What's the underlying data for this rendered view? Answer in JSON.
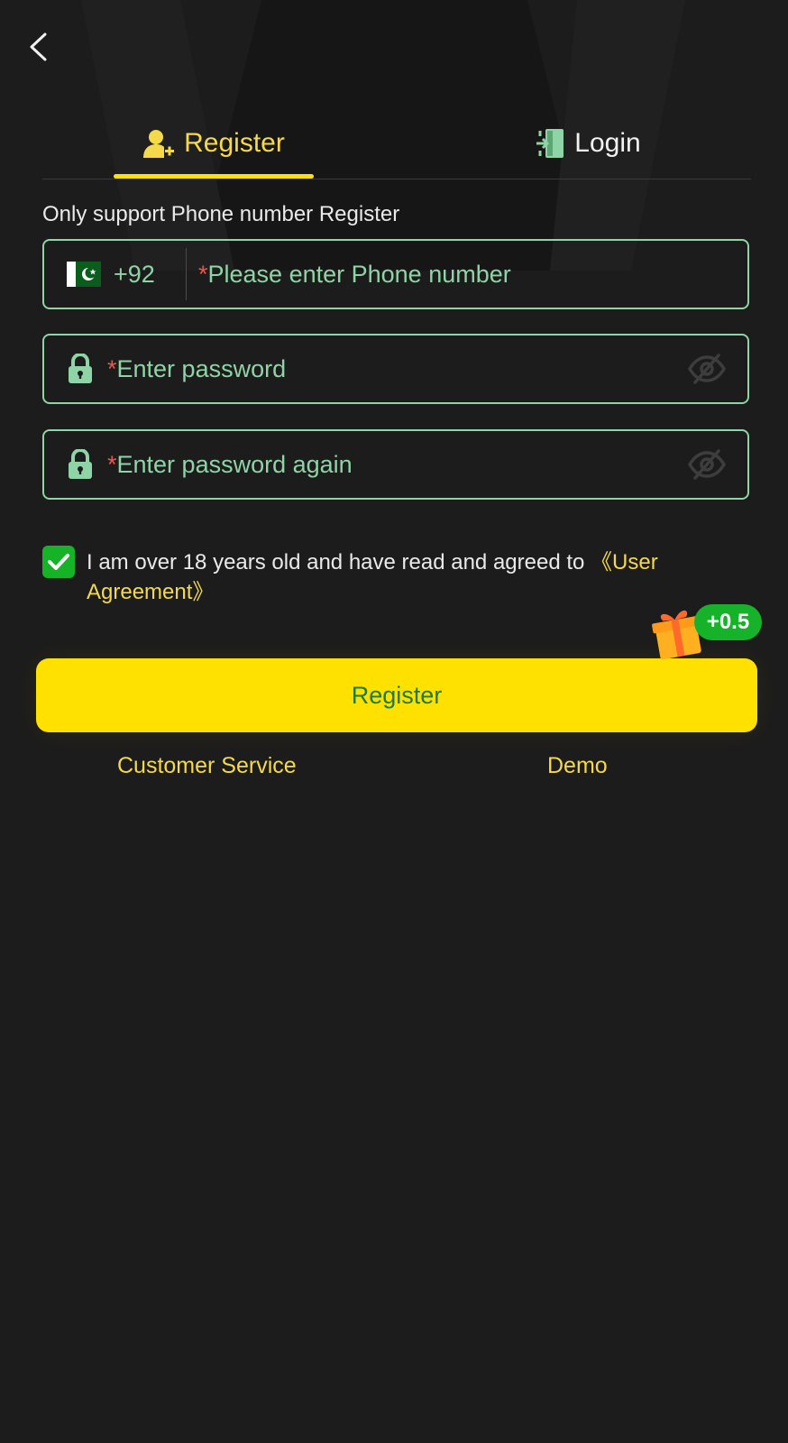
{
  "tabs": {
    "register_label": "Register",
    "login_label": "Login"
  },
  "hint": "Only support Phone number Register",
  "phone": {
    "country_code": "+92",
    "required_mark": "*",
    "placeholder": "Please enter Phone number"
  },
  "password": {
    "required_mark": "*",
    "placeholder": "Enter password"
  },
  "password_again": {
    "required_mark": "*",
    "placeholder": "Enter password again"
  },
  "agreement": {
    "checked": true,
    "text": "I am over 18 years old and have read and agreed to ",
    "link": "《User Agreement》"
  },
  "bonus": "+0.5",
  "register_button": "Register",
  "footer": {
    "customer_service": "Customer Service",
    "demo": "Demo"
  },
  "icons": {
    "back": "chevron-left-icon",
    "register_tab": "user-add-icon",
    "login_tab": "door-enter-icon",
    "flag": "pakistan-flag-icon",
    "lock": "lock-icon",
    "eye": "eye-off-icon",
    "check": "check-icon",
    "gift": "gift-icon"
  },
  "colors": {
    "background": "#1c1c1c",
    "accent_yellow": "#ffe100",
    "tab_active": "#f5d94b",
    "field_border": "#8fd4a6",
    "required": "#e05a4f",
    "checkbox_green": "#17b327",
    "button_text": "#1f7a3d"
  }
}
